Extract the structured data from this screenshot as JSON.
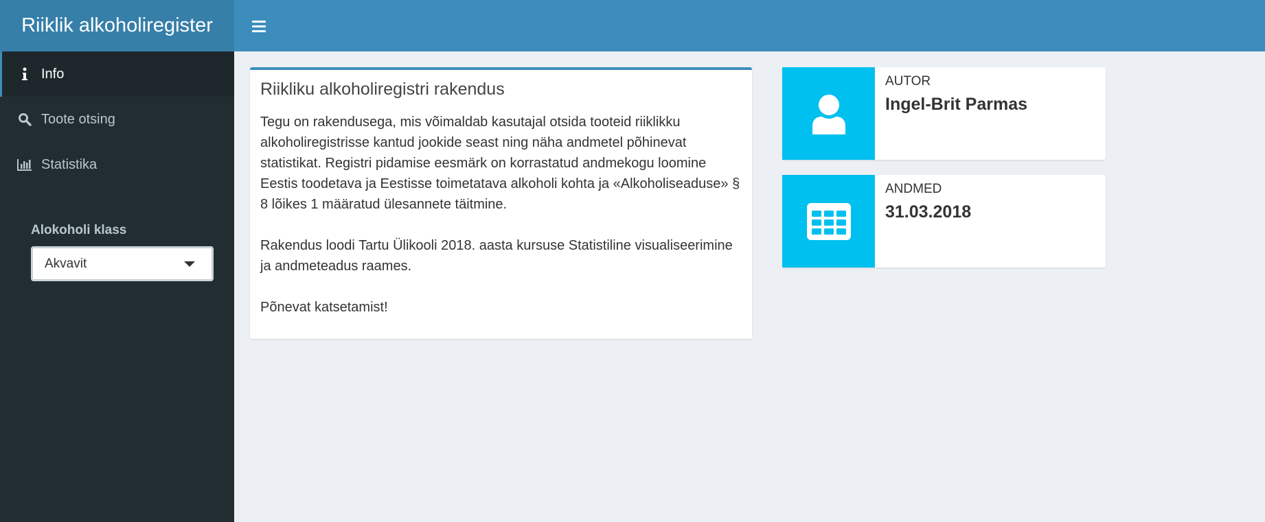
{
  "header": {
    "title": "Riiklik alkoholiregister"
  },
  "sidebar": {
    "items": [
      {
        "label": "Info",
        "icon": "info-icon",
        "active": true
      },
      {
        "label": "Toote otsing",
        "icon": "search-icon",
        "active": false
      },
      {
        "label": "Statistika",
        "icon": "bar-chart-icon",
        "active": false
      }
    ],
    "filter": {
      "label": "Alokoholi klass",
      "selected": "Akvavit"
    }
  },
  "main_box": {
    "title": "Riikliku alkoholiregistri rakendus",
    "paragraphs": [
      "Tegu on rakendusega, mis võimaldab kasutajal otsida tooteid riiklikku alkoholiregistrisse kantud jookide seast ning näha andmetel põhinevat statistikat. Registri pidamise eesmärk on korrastatud andmekogu loomine Eestis toodetava ja Eestisse toimetatava alkoholi kohta ja «Alkoholiseaduse» § 8 lõikes 1 määratud ülesannete täitmine.",
      "Rakendus loodi Tartu Ülikooli 2018. aasta kursuse Statistiline visualiseerimine ja andmeteadus raames.",
      "Põnevat katsetamist!"
    ]
  },
  "info_boxes": [
    {
      "text": "Autor",
      "value": "Ingel-Brit Parmas",
      "icon": "user-icon"
    },
    {
      "text": "Andmed",
      "value": "31.03.2018",
      "icon": "table-icon"
    }
  ],
  "colors": {
    "header": "#3c8dbc",
    "logo": "#367fa9",
    "sidebar": "#222d32",
    "info_box_icon": "#00c0ef",
    "background": "#ecf0f5"
  }
}
